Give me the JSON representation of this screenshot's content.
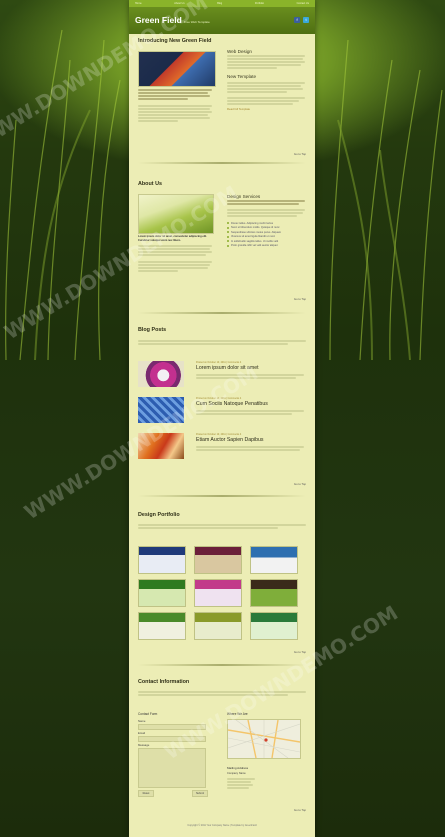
{
  "nav": {
    "items": [
      "Home",
      "About Us",
      "Blog",
      "Portfolio",
      "Contact Us"
    ]
  },
  "header": {
    "logo": "Green Field",
    "tagline": "Free Web Template"
  },
  "intro": {
    "title": "Introducing New Green Field",
    "web_design": "Web Design",
    "new_template": "New Template",
    "read_more": "Read full Template",
    "to_top": "Go to Top"
  },
  "about": {
    "title": "About Us",
    "services_title": "Design Services",
    "lead": "Lorem ipsum dolor sit amet, consectetur adipiscing elit. Curabitur volutpat enim nec libero.",
    "services": [
      "Donec tellus. Adipiscing morbi luctus",
      "Nunc ut bibendum mollis. Quisque id nunc",
      "Suspendisse ultricies metus purus. Aliquam",
      "Vivamus sit amet ligula blandit ut nunc",
      "In sollicitudin sagittis tellus. Ut mollis velit",
      "Proin gravida nibh vel velit auctor aliquet"
    ],
    "to_top": "Go to Top"
  },
  "blog": {
    "title": "Blog Posts",
    "posts": [
      {
        "meta": "Posted on October 10, 2011 | Comments 4",
        "title": "Lorem ipsum dolor sit amet"
      },
      {
        "meta": "Posted on October 10, 2011 | Comments 4",
        "title": "Cum Sociis Natoque Penatibus"
      },
      {
        "meta": "Posted on October 10, 2011 | Comments 4",
        "title": "Etiam Auctor Sapien Dapibus"
      }
    ],
    "to_top": "Go to Top"
  },
  "portfolio": {
    "title": "Design Portfolio",
    "to_top": "Go to Top"
  },
  "contact": {
    "title": "Contact Information",
    "form_title": "Contact Form",
    "name_label": "Name",
    "email_label": "Email",
    "message_label": "Message",
    "reset": "Reset",
    "submit": "Submit",
    "where_title": "Where We Are",
    "mailing_title": "Mailing Address",
    "company": "Company Name",
    "to_top": "Go to Top"
  },
  "footer": {
    "text": "Copyright © 2011 Your Company Name | Template by GreenField"
  },
  "watermark": "WWW.DOWNDEMO.COM",
  "colors": {
    "accent": "#8ab32a",
    "paper": "#ecedb5",
    "background": "#24390e"
  }
}
